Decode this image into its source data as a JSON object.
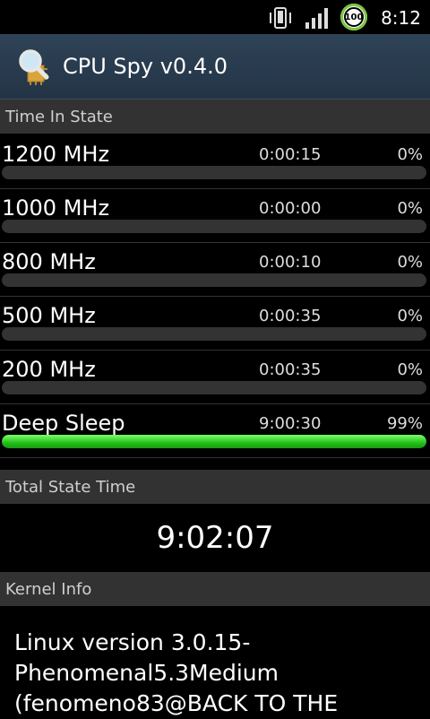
{
  "status_bar": {
    "time": "8:12",
    "battery_level": "100",
    "icons": [
      "vibrate-icon",
      "signal-icon",
      "battery-icon"
    ]
  },
  "app": {
    "title": "CPU Spy v0.4.0",
    "icon": "magnifier-chip-icon"
  },
  "sections": {
    "time_in_state": "Time In State",
    "total_state_time": "Total State Time",
    "kernel_info": "Kernel Info"
  },
  "states": [
    {
      "name": "1200 MHz",
      "time": "0:00:15",
      "percent": "0%",
      "fraction": 0.0
    },
    {
      "name": "1000 MHz",
      "time": "0:00:00",
      "percent": "0%",
      "fraction": 0.0
    },
    {
      "name": "800 MHz",
      "time": "0:00:10",
      "percent": "0%",
      "fraction": 0.0
    },
    {
      "name": "500 MHz",
      "time": "0:00:35",
      "percent": "0%",
      "fraction": 0.0
    },
    {
      "name": "200 MHz",
      "time": "0:00:35",
      "percent": "0%",
      "fraction": 0.0
    },
    {
      "name": "Deep Sleep",
      "time": "9:00:30",
      "percent": "99%",
      "fraction": 1.0
    }
  ],
  "total_time": "9:02:07",
  "kernel_info": "Linux version 3.0.15-Phenomenal5.3Medium (fenomeno83@BACK TO THE",
  "colors": {
    "bar_fill": "#23c01a",
    "bar_track": "#333333",
    "header_bg": "#2f4357",
    "section_bg": "#323232"
  }
}
